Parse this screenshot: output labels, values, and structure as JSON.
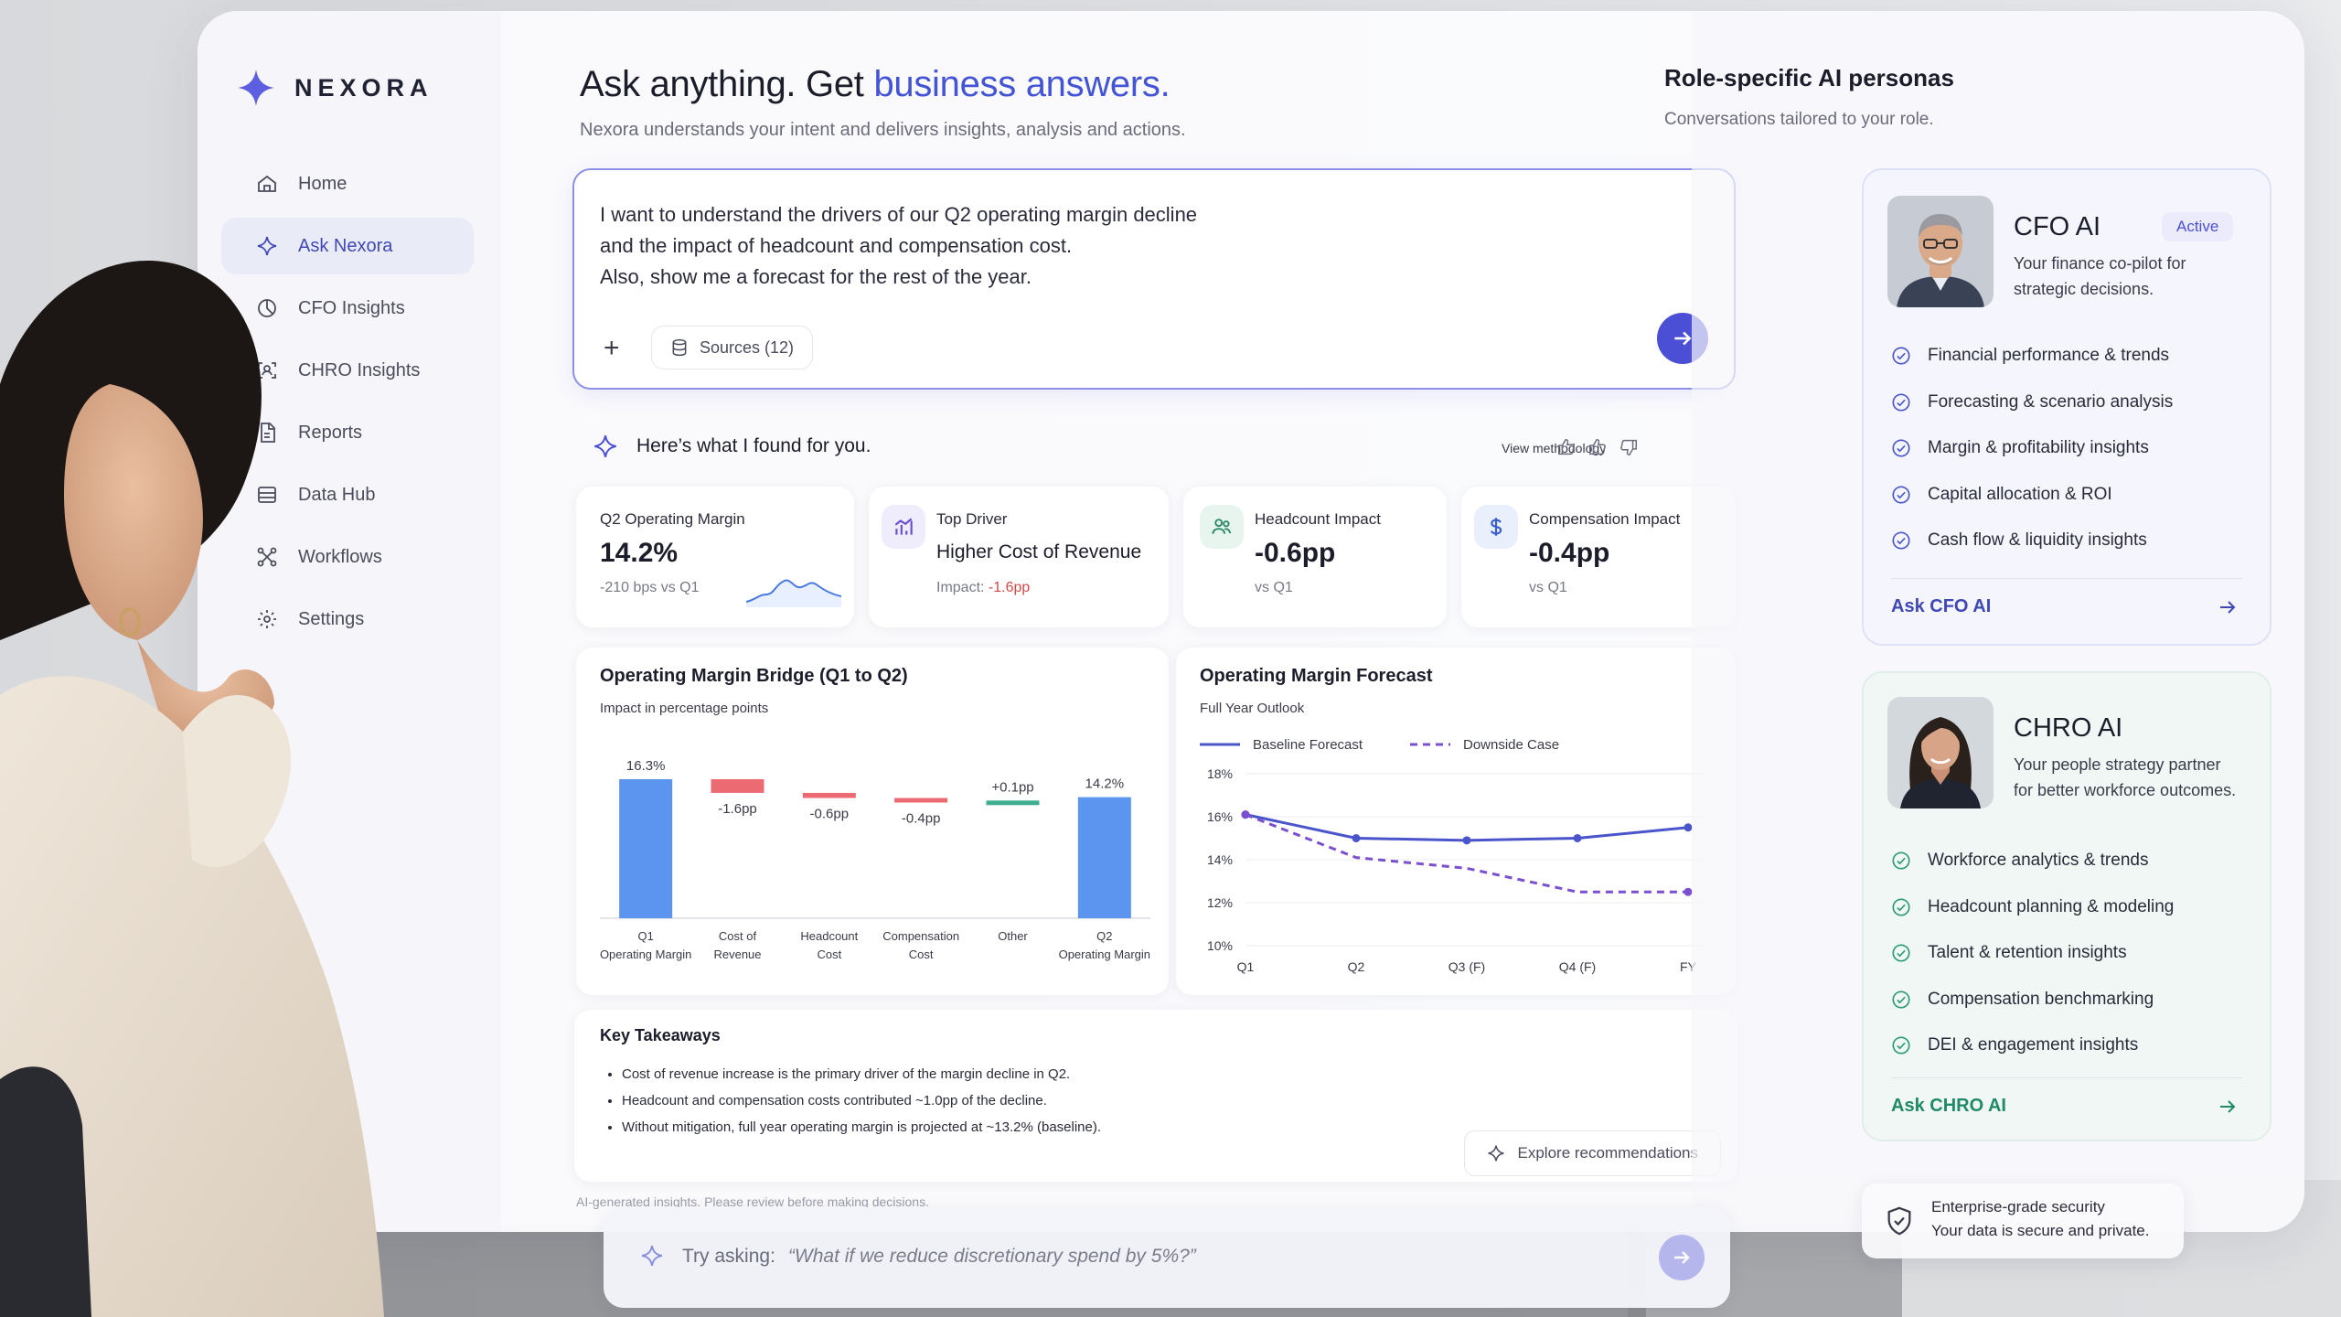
{
  "brand": {
    "name": "NEXORA"
  },
  "nav": [
    {
      "label": "Home",
      "icon": "home-icon"
    },
    {
      "label": "Ask Nexora",
      "icon": "sparkle-icon",
      "active": true
    },
    {
      "label": "CFO Insights",
      "icon": "pie-chart-icon"
    },
    {
      "label": "CHRO Insights",
      "icon": "users-scan-icon"
    },
    {
      "label": "Reports",
      "icon": "document-icon"
    },
    {
      "label": "Data Hub",
      "icon": "database-icon"
    },
    {
      "label": "Workflows",
      "icon": "workflow-icon"
    },
    {
      "label": "Settings",
      "icon": "gear-icon"
    }
  ],
  "hero": {
    "title_prefix": "Ask anything. Get ",
    "title_highlight": "business answers.",
    "subtitle": "Nexora understands your intent and delivers insights, analysis and actions."
  },
  "prompt": {
    "lines": [
      "I want to understand the drivers of our Q2 operating margin decline",
      "and the impact of headcount and compensation cost.",
      "Also, show me a forecast for the rest of the year."
    ],
    "sources_label": "Sources (12)"
  },
  "result": {
    "heading": "Here’s what I found for you.",
    "methodology_link": "View methodology"
  },
  "kpis": [
    {
      "label": "Q2 Operating Margin",
      "value": "14.2%",
      "delta": "-210 bps vs Q1"
    },
    {
      "label": "Top Driver",
      "value": "Higher Cost of Revenue",
      "impact_prefix": "Impact: ",
      "impact_value": "-1.6pp"
    },
    {
      "label": "Headcount Impact",
      "value": "-0.6pp",
      "sub": "vs Q1"
    },
    {
      "label": "Compensation Impact",
      "value": "-0.4pp",
      "sub": "vs Q1"
    }
  ],
  "bridge": {
    "title": "Operating Margin Bridge (Q1 to Q2)",
    "subtitle": "Impact in percentage points"
  },
  "forecast": {
    "title": "Operating Margin Forecast",
    "subtitle": "Full Year Outlook"
  },
  "chart_data": [
    {
      "type": "bar",
      "subtype": "waterfall",
      "title": "Operating Margin Bridge (Q1 to Q2)",
      "subtitle": "Impact in percentage points",
      "categories": [
        [
          "Q1",
          "Operating Margin"
        ],
        [
          "Cost of",
          "Revenue"
        ],
        [
          "Headcount",
          "Cost"
        ],
        [
          "Compensation",
          "Cost"
        ],
        [
          "Other"
        ],
        [
          "Q2",
          "Operating Margin"
        ]
      ],
      "values": [
        16.3,
        -1.6,
        -0.6,
        -0.4,
        0.1,
        14.2
      ],
      "labels": [
        "16.3%",
        "-1.6pp",
        "-0.6pp",
        "-0.4pp",
        "+0.1pp",
        "14.2%"
      ],
      "colors": {
        "total": "#5b95f0",
        "negative": "#ec6b73",
        "positive": "#3dae8f"
      },
      "ylim": [
        0,
        16.3
      ]
    },
    {
      "type": "line",
      "title": "Operating Margin Forecast",
      "subtitle": "Full Year Outlook",
      "x": [
        "Q1",
        "Q2",
        "Q3 (F)",
        "Q4 (F)",
        "FY"
      ],
      "series": [
        {
          "name": "Baseline Forecast",
          "values": [
            16.1,
            15.0,
            14.9,
            15.0,
            15.5
          ],
          "style": "solid",
          "color": "#4a55cc"
        },
        {
          "name": "Downside Case",
          "values": [
            16.1,
            14.1,
            13.6,
            12.5,
            12.5
          ],
          "style": "dashed",
          "color": "#7a4fd0"
        }
      ],
      "ylim": [
        10,
        18
      ],
      "yticks": [
        "10%",
        "12%",
        "14%",
        "16%",
        "18%"
      ],
      "grid": true,
      "legend": "top-left"
    }
  ],
  "takeaways": {
    "title": "Key Takeaways",
    "items": [
      "Cost of revenue increase is the primary driver of the margin decline in Q2.",
      "Headcount and compensation costs contributed ~1.0pp of the decline.",
      "Without mitigation, full year operating margin is projected at ~13.2% (baseline)."
    ],
    "explore_label": "Explore recommendations"
  },
  "disclaimer": "AI-generated insights. Please review before making decisions.",
  "ask_bar": {
    "prefix": "Try asking:",
    "suggestion": "“What if we reduce discretionary spend by 5%?”"
  },
  "personas_panel": {
    "title": "Role-specific AI personas",
    "subtitle": "Conversations tailored to your role.",
    "cfo": {
      "name": "CFO AI",
      "badge": "Active",
      "desc_lines": [
        "Your finance co-pilot for",
        "strategic decisions."
      ],
      "features": [
        "Financial performance & trends",
        "Forecasting & scenario analysis",
        "Margin & profitability insights",
        "Capital allocation & ROI",
        "Cash flow & liquidity insights"
      ],
      "cta": "Ask CFO AI",
      "accent": "#4048b6"
    },
    "chro": {
      "name": "CHRO AI",
      "desc_lines": [
        "Your people strategy partner",
        "for better workforce outcomes."
      ],
      "features": [
        "Workforce analytics & trends",
        "Headcount planning & modeling",
        "Talent & retention insights",
        "Compensation benchmarking",
        "DEI & engagement insights"
      ],
      "cta": "Ask CHRO AI",
      "accent": "#1f8a68"
    }
  },
  "security": {
    "line1": "Enterprise-grade security",
    "line2": "Your data is secure and private."
  }
}
